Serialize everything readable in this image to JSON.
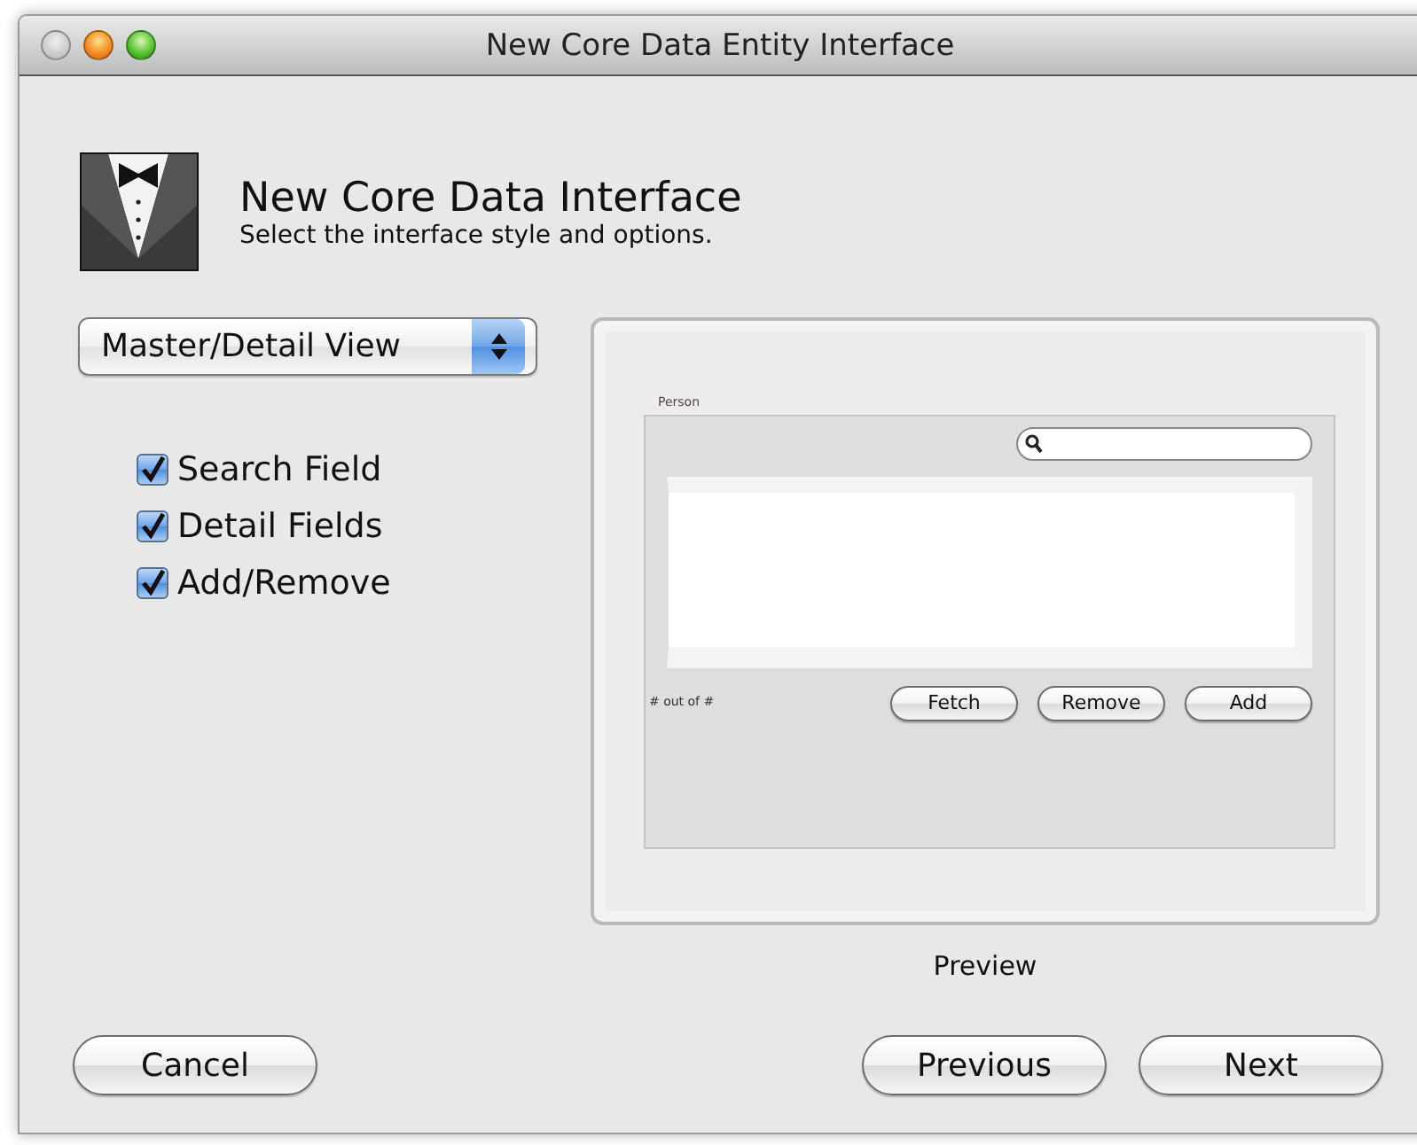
{
  "window": {
    "title": "New Core Data Entity Interface"
  },
  "header": {
    "title": "New Core Data Interface",
    "subtitle": "Select the interface style and options."
  },
  "style_popup": {
    "value": "Master/Detail View"
  },
  "options": [
    {
      "label": "Search Field",
      "checked": true
    },
    {
      "label": "Detail Fields",
      "checked": true
    },
    {
      "label": "Add/Remove",
      "checked": true
    }
  ],
  "preview": {
    "label": "Preview",
    "entity": "Person",
    "count_text": "# out of #",
    "buttons": [
      "Fetch",
      "Remove",
      "Add"
    ]
  },
  "buttons": [
    "Cancel",
    "Previous",
    "Next"
  ]
}
